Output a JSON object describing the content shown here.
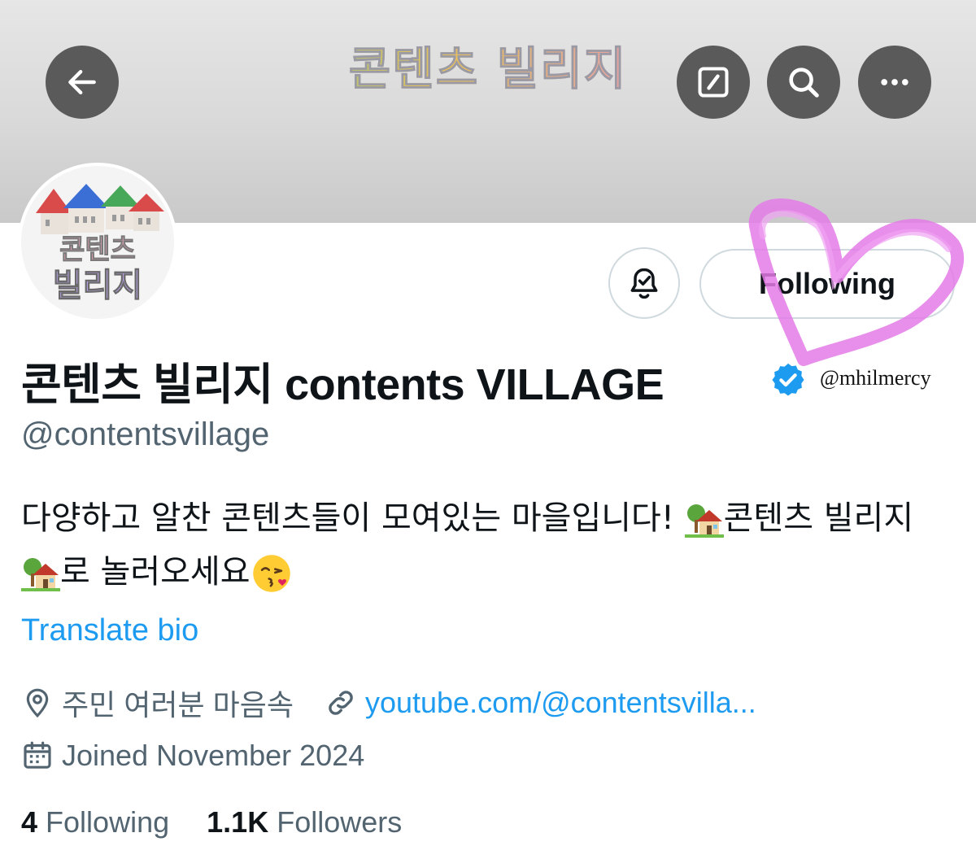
{
  "header": {
    "banner_title": "콘텐츠 빌리지"
  },
  "actions": {
    "following_label": "Following"
  },
  "profile": {
    "display_name": "콘텐츠 빌리지 contents VILLAGE",
    "handle": "@contentsvillage",
    "bio_line1": "다양하고 알찬 콘텐츠들이 모여있는 마을입니다! ",
    "bio_line1_tail": "콘텐츠 빌리지",
    "bio_line2": "로 놀러오세요",
    "translate_label": "Translate bio",
    "location": "주민 여러분 마음속",
    "website": "youtube.com/@contentsvilla...",
    "joined": "Joined November 2024",
    "following_count": "4",
    "following_label": "Following",
    "followers_count": "1.1K",
    "followers_label": "Followers"
  },
  "overlay": {
    "watermark": "@mhilmercy",
    "heart_color": "#e47ae8"
  },
  "colors": {
    "accent": "#1d9bf0",
    "secondary_text": "#536471",
    "verified": "#1d9bf0"
  },
  "avatar": {
    "text_line1": "콘텐츠",
    "text_line2": "빌리지"
  }
}
